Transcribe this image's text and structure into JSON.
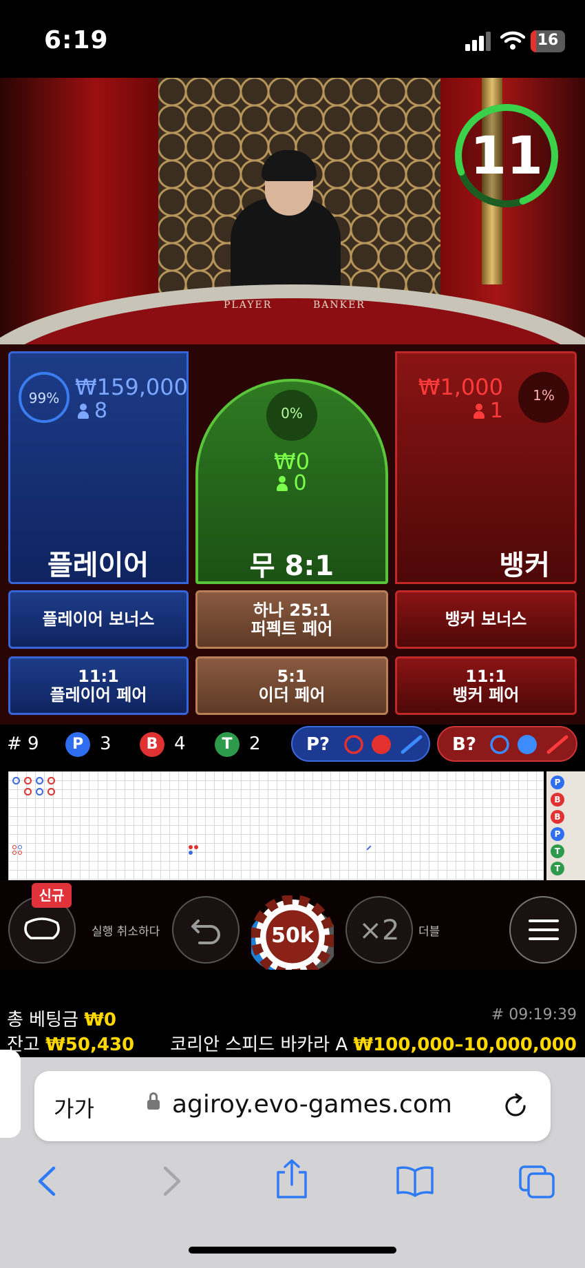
{
  "status_bar": {
    "time": "6:19",
    "battery": "16",
    "battery_level": 0.16
  },
  "timer": {
    "seconds": "11",
    "color": "#3bd14a"
  },
  "table_labels": {
    "player": "PLAYER",
    "banker": "BANKER"
  },
  "bets": {
    "player": {
      "percent": "99%",
      "amount": "₩159,000",
      "count": "8",
      "title": "플레이어",
      "color": "#3565d8"
    },
    "tie": {
      "percent": "0%",
      "amount": "₩0",
      "count": "0",
      "title": "무 8:1",
      "color": "#5ac53a"
    },
    "banker": {
      "percent": "1%",
      "amount": "₩1,000",
      "count": "1",
      "title": "뱅커",
      "color": "#e53030"
    }
  },
  "side_bets": {
    "player_bonus": "플레이어 보너스",
    "perfect_pair": {
      "line1": "하나 25:1",
      "line2": "퍼펙트 페어"
    },
    "banker_bonus": "뱅커 보너스",
    "player_pair": {
      "line1": "11:1",
      "line2": "플레이어 페어"
    },
    "either_pair": {
      "line1": "5:1",
      "line2": "이더 페어"
    },
    "banker_pair": {
      "line1": "11:1",
      "line2": "뱅커 페어"
    }
  },
  "stats": {
    "round": "# 9",
    "player": {
      "letter": "P",
      "count": "3"
    },
    "banker": {
      "letter": "B",
      "count": "4"
    },
    "tie": {
      "letter": "T",
      "count": "2"
    },
    "ask_player": "P?",
    "ask_banker": "B?"
  },
  "bead_road": [
    "P",
    "B",
    "B",
    "P",
    "T",
    "T"
  ],
  "controls": {
    "new_badge": "신규",
    "undo_label": "실행 취소하다",
    "chip_value": "50k",
    "double_symbol": "×2",
    "double_label": "더블"
  },
  "info": {
    "total_bet_label": "총 베팅금",
    "total_bet": "₩0",
    "balance_label": "잔고",
    "balance": "₩50,430",
    "time": "# 09:19:39",
    "table_name": "코리안 스피드 바카라 A",
    "limits": "₩100,000–10,000,000"
  },
  "browser": {
    "text_size": "가가",
    "url": "agiroy.evo-games.com"
  },
  "colors": {
    "blue": "#1d3c88",
    "red": "#8a1414",
    "green": "#2f7a22",
    "gold": "#ffd800"
  }
}
